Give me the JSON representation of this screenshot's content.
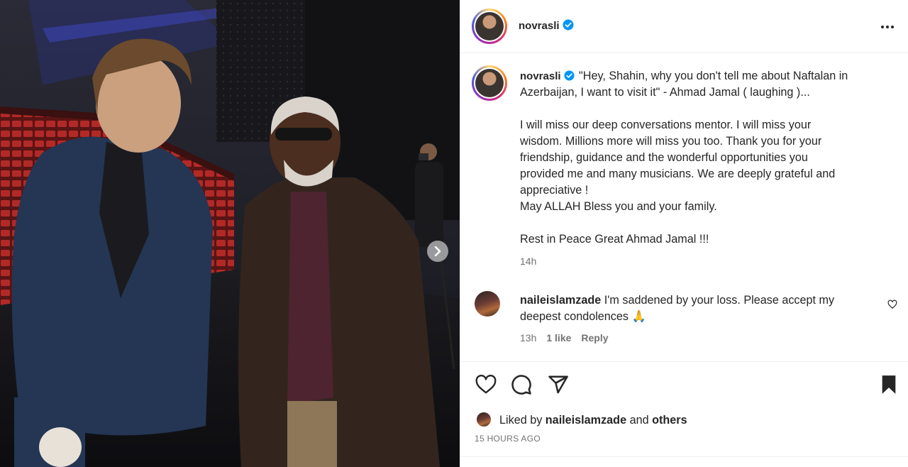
{
  "post": {
    "author": "novrasli",
    "verified": true,
    "caption_lines": [
      "\"Hey, Shahin, why you don't tell me about Naftalan in",
      "Azerbaijan, I want to visit it\" - Ahmad Jamal ( laughing )...",
      "",
      "I will miss our deep conversations mentor. I will miss your",
      "wisdom. Millions more will miss you too. Thank you for your",
      "friendship, guidance and the wonderful opportunities you",
      "provided me and many musicians. We are deeply grateful and",
      "appreciative !",
      "May ALLAH Bless you and your family.",
      "",
      "Rest in Peace Great Ahmad Jamal !!!"
    ],
    "caption_time": "14h",
    "liked_by_prefix": "Liked by",
    "liked_by_user": "naileislamzade",
    "liked_by_and": "and",
    "liked_by_others": "others",
    "date": "15 HOURS AGO"
  },
  "comment": {
    "username": "naileislamzade",
    "text_line1": "I'm saddened by your loss. Please accept my",
    "text_line2": "deepest condolences 🙏",
    "time": "13h",
    "likes": "1 like",
    "reply": "Reply"
  },
  "icons": {
    "verified": "verified-badge-icon",
    "more": "more-options-icon",
    "heart": "heart-icon",
    "comment": "comment-icon",
    "share": "share-icon",
    "save": "bookmark-icon",
    "next": "chevron-right-icon"
  },
  "colors": {
    "verified": "#0095f6",
    "text": "#262626",
    "secondary": "#737373",
    "divider": "#efefef"
  }
}
